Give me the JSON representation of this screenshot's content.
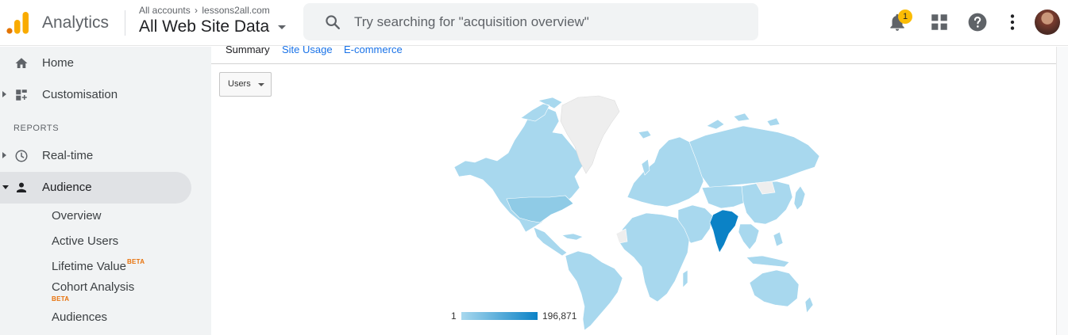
{
  "header": {
    "brand": "Analytics",
    "account_path": {
      "account": "All accounts",
      "property": "lessons2all.com"
    },
    "view_name": "All Web Site Data",
    "search": {
      "placeholder": "Try searching for \"acquisition overview\""
    },
    "notifications": {
      "count": "1"
    },
    "icons": [
      "bell-icon",
      "apps-grid-icon",
      "help-icon",
      "more-vert-icon",
      "avatar"
    ]
  },
  "sidebar": {
    "items": [
      {
        "label": "Home",
        "icon": "home-icon"
      },
      {
        "label": "Customisation",
        "icon": "dashboard-customise-icon"
      }
    ],
    "reports_label": "REPORTS",
    "report_items": [
      {
        "label": "Real-time",
        "icon": "clock-icon"
      },
      {
        "label": "Audience",
        "icon": "person-icon"
      }
    ],
    "audience_subitems": [
      {
        "label": "Overview"
      },
      {
        "label": "Active Users"
      },
      {
        "label": "Lifetime Value",
        "badge": "BETA"
      },
      {
        "label": "Cohort Analysis",
        "badge": "BETA"
      },
      {
        "label": "Audiences"
      }
    ]
  },
  "main": {
    "tabs": [
      {
        "label": "Summary"
      },
      {
        "label": "Site Usage"
      },
      {
        "label": "E-commerce"
      }
    ],
    "metric_dropdown": {
      "selected": "Users"
    },
    "map": {
      "legend_min": "1",
      "legend_max": "196,871",
      "colors": {
        "low": "#a8d8ee",
        "high": "#0b82c6",
        "no_data": "#eeeeee"
      }
    }
  }
}
